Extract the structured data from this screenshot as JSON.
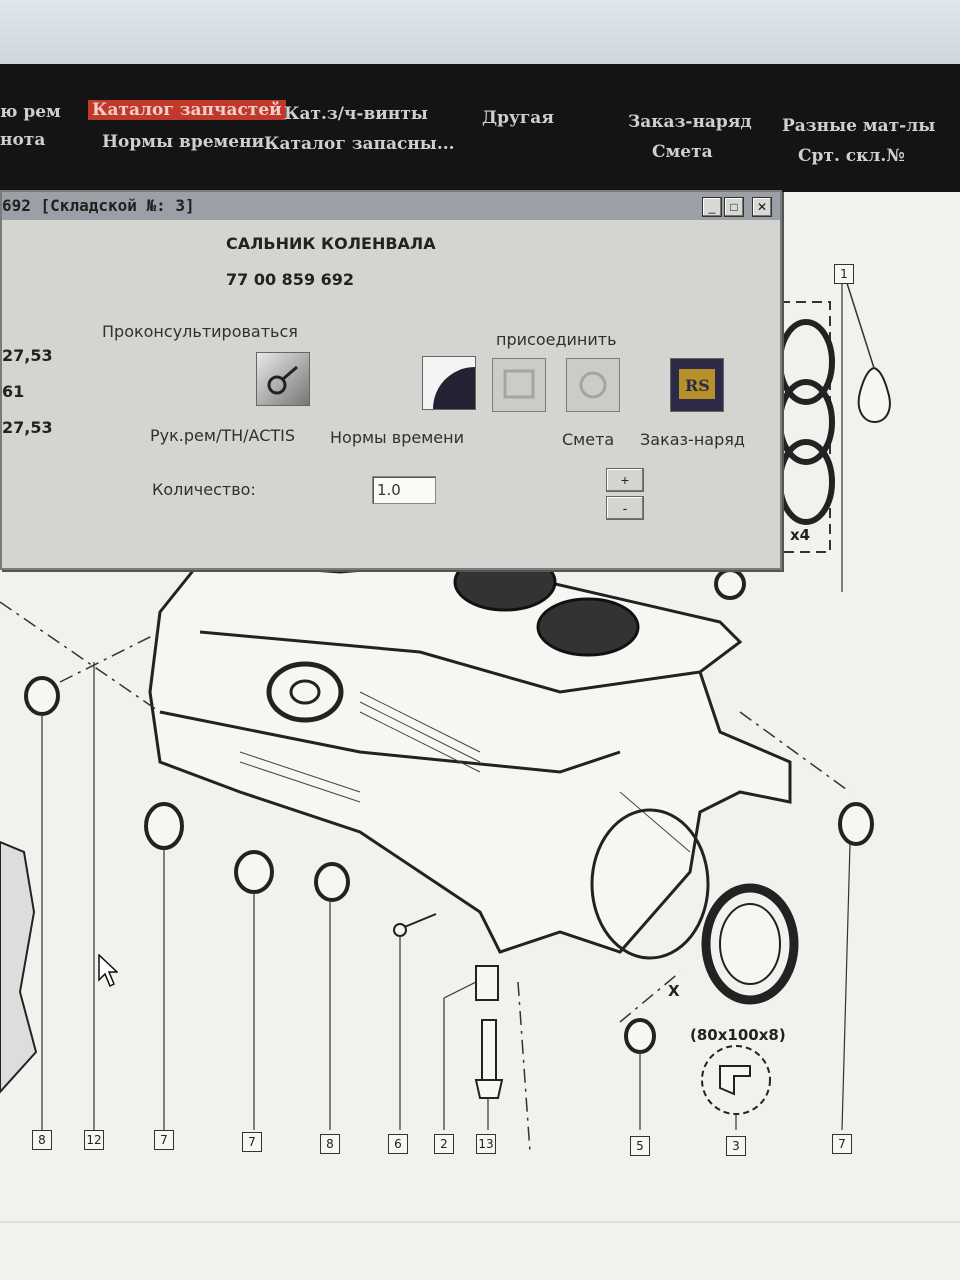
{
  "menu": {
    "items": [
      {
        "label": "ю рем",
        "active": false
      },
      {
        "label": "Каталог запчастей",
        "active": true
      },
      {
        "label": "Кат.з/ч-винты",
        "active": false
      },
      {
        "label": "Другая",
        "active": false
      },
      {
        "label": "Заказ-наряд",
        "active": false
      },
      {
        "label": "Разные мат-лы",
        "active": false
      },
      {
        "label": "нота",
        "active": false
      },
      {
        "label": "Нормы времени",
        "active": false
      },
      {
        "label": "Каталог запасны...",
        "active": false
      },
      {
        "label": "Смета",
        "active": false
      },
      {
        "label": "Срт. скл.№",
        "active": false
      }
    ],
    "active_color": "#c0392b"
  },
  "dialog": {
    "title": "692 [Складской №: 3]",
    "part_name": "САЛЬНИК КОЛЕНВАЛА",
    "part_number": "77 00 859 692",
    "left_values": [
      "27,53",
      "61",
      "27,53"
    ],
    "consult_label": "Проконсультироваться",
    "attach_label": "присоединить",
    "actions": [
      {
        "label": "Рук.рем/TH/ACTIS",
        "icon": "repair-manual-icon"
      },
      {
        "label": "Нормы времени",
        "icon": "clock-icon"
      },
      {
        "label": "Смета",
        "icon": "estimate-icon"
      },
      {
        "label": "Заказ-наряд",
        "icon": "work-order-icon"
      }
    ],
    "quantity_label": "Количество:",
    "quantity_value": "1.0",
    "plus_label": "+",
    "minus_label": "-",
    "window_buttons": {
      "minimize": "_",
      "maximize": "□",
      "close": "✕"
    }
  },
  "diagram": {
    "callouts": [
      "1",
      "8",
      "12",
      "7",
      "7",
      "8",
      "6",
      "2",
      "13",
      "5",
      "3",
      "7"
    ],
    "x4_label": "x4",
    "x_label": "X",
    "seal_size": "(80x100x8)"
  }
}
